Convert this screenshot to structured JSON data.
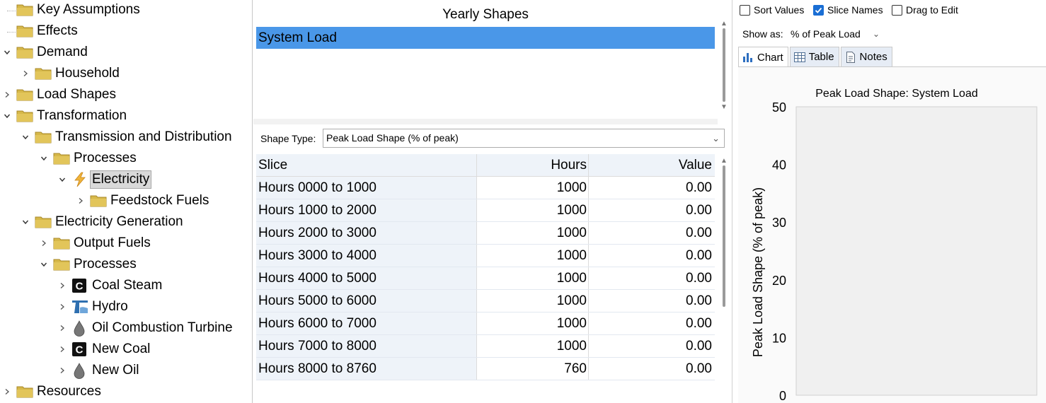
{
  "tree": {
    "items": [
      {
        "label": "Key Assumptions",
        "depth": 0,
        "expander": "none",
        "icon": "folder-icon"
      },
      {
        "label": "Effects",
        "depth": 0,
        "expander": "none",
        "icon": "folder-icon"
      },
      {
        "label": "Demand",
        "depth": 0,
        "expander": "expanded",
        "icon": "folder-icon"
      },
      {
        "label": "Household",
        "depth": 1,
        "expander": "collapsed",
        "icon": "folder-icon"
      },
      {
        "label": "Load Shapes",
        "depth": 0,
        "expander": "collapsed",
        "icon": "folder-icon"
      },
      {
        "label": "Transformation",
        "depth": 0,
        "expander": "expanded",
        "icon": "folder-icon"
      },
      {
        "label": "Transmission and Distribution",
        "depth": 1,
        "expander": "expanded",
        "icon": "folder-icon"
      },
      {
        "label": "Processes",
        "depth": 2,
        "expander": "expanded",
        "icon": "folder-icon"
      },
      {
        "label": "Electricity",
        "depth": 3,
        "expander": "expanded",
        "icon": "lightning-icon",
        "selected": true
      },
      {
        "label": "Feedstock Fuels",
        "depth": 4,
        "expander": "collapsed",
        "icon": "folder-icon"
      },
      {
        "label": "Electricity Generation",
        "depth": 1,
        "expander": "expanded",
        "icon": "folder-icon"
      },
      {
        "label": "Output Fuels",
        "depth": 2,
        "expander": "collapsed",
        "icon": "folder-icon"
      },
      {
        "label": "Processes",
        "depth": 2,
        "expander": "expanded",
        "icon": "folder-icon"
      },
      {
        "label": "Coal Steam",
        "depth": 3,
        "expander": "collapsed",
        "icon": "coal-icon"
      },
      {
        "label": "Hydro",
        "depth": 3,
        "expander": "collapsed",
        "icon": "hydro-icon"
      },
      {
        "label": "Oil Combustion Turbine",
        "depth": 3,
        "expander": "collapsed",
        "icon": "oil-drop-icon"
      },
      {
        "label": "New Coal",
        "depth": 3,
        "expander": "collapsed",
        "icon": "coal-icon"
      },
      {
        "label": "New Oil",
        "depth": 3,
        "expander": "collapsed",
        "icon": "oil-drop-icon"
      },
      {
        "label": "Resources",
        "depth": 0,
        "expander": "collapsed",
        "icon": "folder-icon"
      }
    ]
  },
  "yearly": {
    "header": "Yearly Shapes",
    "items": [
      "System Load"
    ]
  },
  "shape_type": {
    "label": "Shape Type:",
    "value": "Peak Load Shape (% of peak)"
  },
  "grid": {
    "columns": [
      "Slice",
      "Hours",
      "Value"
    ],
    "rows": [
      {
        "slice": "Hours 0000 to 1000",
        "hours": "1000",
        "value": "0.00"
      },
      {
        "slice": "Hours 1000 to 2000",
        "hours": "1000",
        "value": "0.00"
      },
      {
        "slice": "Hours 2000 to 3000",
        "hours": "1000",
        "value": "0.00"
      },
      {
        "slice": "Hours 3000 to 4000",
        "hours": "1000",
        "value": "0.00"
      },
      {
        "slice": "Hours 4000 to 5000",
        "hours": "1000",
        "value": "0.00"
      },
      {
        "slice": "Hours 5000 to 6000",
        "hours": "1000",
        "value": "0.00"
      },
      {
        "slice": "Hours 6000 to 7000",
        "hours": "1000",
        "value": "0.00"
      },
      {
        "slice": "Hours 7000 to 8000",
        "hours": "1000",
        "value": "0.00"
      },
      {
        "slice": "Hours 8000 to 8760",
        "hours": "760",
        "value": "0.00"
      }
    ]
  },
  "options": {
    "sort_values": {
      "label": "Sort Values",
      "checked": false
    },
    "slice_names": {
      "label": "Slice Names",
      "checked": true
    },
    "drag_to_edit": {
      "label": "Drag to Edit",
      "checked": false
    },
    "show_as_label": "Show as:",
    "show_as_value": "% of Peak Load"
  },
  "tabs": [
    {
      "label": "Chart",
      "icon": "bar-chart-icon",
      "active": true
    },
    {
      "label": "Table",
      "icon": "table-icon",
      "active": false
    },
    {
      "label": "Notes",
      "icon": "notes-icon",
      "active": false
    }
  ],
  "colors": {
    "selection": "#4a97e8",
    "folder": "#d6b84a",
    "checkbox_on": "#1a6ed4"
  },
  "chart_data": {
    "type": "bar",
    "title": "Peak Load Shape: System Load",
    "ylabel": "Peak Load Shape (% of peak)",
    "xlabel": "",
    "ylim": [
      0,
      50
    ],
    "yticks": [
      0,
      10,
      20,
      30,
      40,
      50
    ],
    "categories": [
      "Hours 0000 to 1000",
      "Hours 1000 to 2000",
      "Hours 2000 to 3000",
      "Hours 3000 to 4000",
      "Hours 4000 to 5000",
      "Hours 5000 to 6000",
      "Hours 6000 to 7000",
      "Hours 7000 to 8000",
      "Hours 8000 to 8760"
    ],
    "values": [
      0,
      0,
      0,
      0,
      0,
      0,
      0,
      0,
      0
    ]
  }
}
